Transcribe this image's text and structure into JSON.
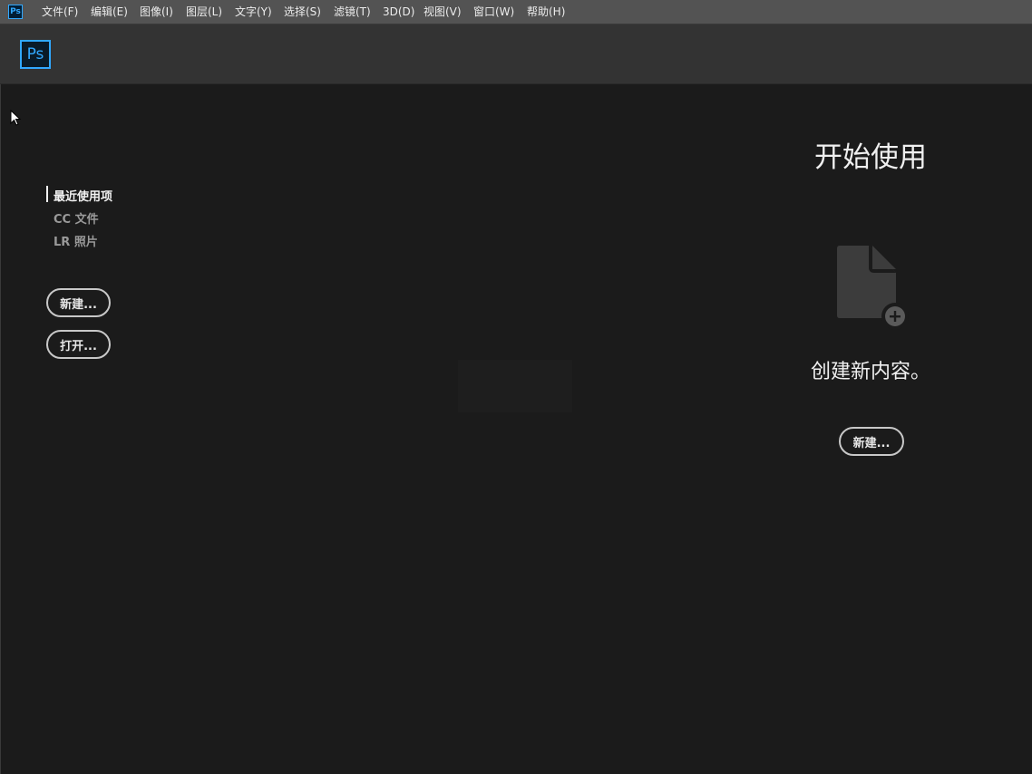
{
  "menubar": {
    "app_icon": "Ps",
    "items": [
      "文件(F)",
      "编辑(E)",
      "图像(I)",
      "图层(L)",
      "文字(Y)",
      "选择(S)",
      "滤镜(T)",
      "3D(D)",
      "视图(V)",
      "窗口(W)",
      "帮助(H)"
    ]
  },
  "header": {
    "logo": "Ps"
  },
  "nav": {
    "items": [
      {
        "label": "最近使用项",
        "active": true
      },
      {
        "label": "CC 文件",
        "active": false
      },
      {
        "label": "LR 照片",
        "active": false
      }
    ]
  },
  "actions": {
    "new_label": "新建...",
    "open_label": "打开..."
  },
  "start": {
    "title": "开始使用",
    "create_text": "创建新内容。",
    "new_label": "新建..."
  },
  "colors": {
    "accent": "#31a8ff",
    "background": "#1b1b1b",
    "menubar": "#535353",
    "header": "#333333"
  }
}
